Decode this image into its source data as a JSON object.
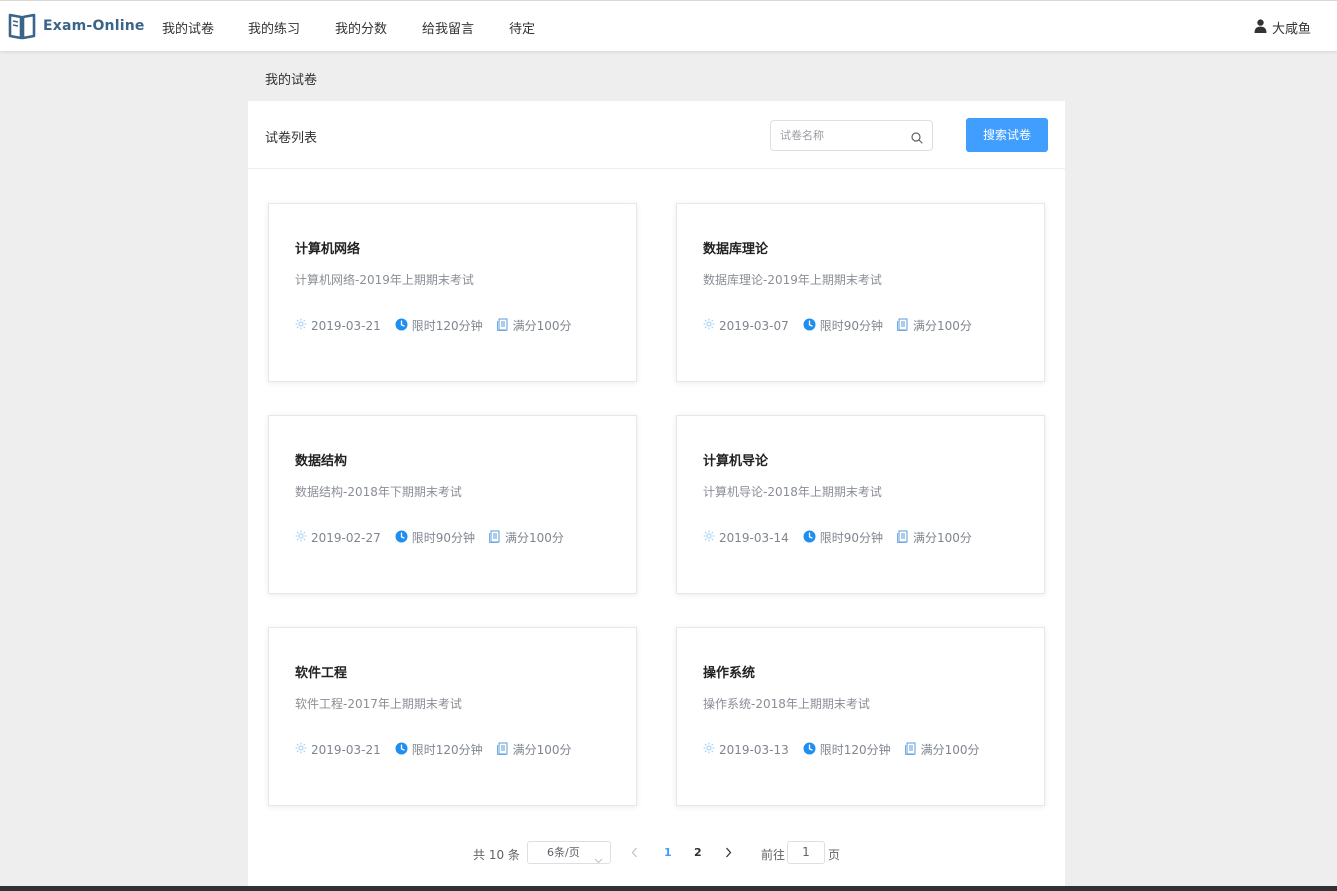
{
  "header": {
    "logo_text": "Exam-Online",
    "nav": [
      "我的试卷",
      "我的练习",
      "我的分数",
      "给我留言",
      "待定"
    ],
    "user_name": "大咸鱼"
  },
  "breadcrumb": "我的试卷",
  "panel": {
    "title": "试卷列表",
    "search_placeholder": "试卷名称",
    "search_button": "搜索试卷"
  },
  "cards": [
    {
      "title": "计算机网络",
      "desc": "计算机网络-2019年上期期末考试",
      "date": "2019-03-21",
      "time": "限时120分钟",
      "score": "满分100分"
    },
    {
      "title": "数据库理论",
      "desc": "数据库理论-2019年上期期末考试",
      "date": "2019-03-07",
      "time": "限时90分钟",
      "score": "满分100分"
    },
    {
      "title": "数据结构",
      "desc": "数据结构-2018年下期期末考试",
      "date": "2019-02-27",
      "time": "限时90分钟",
      "score": "满分100分"
    },
    {
      "title": "计算机导论",
      "desc": "计算机导论-2018年上期期末考试",
      "date": "2019-03-14",
      "time": "限时90分钟",
      "score": "满分100分"
    },
    {
      "title": "软件工程",
      "desc": "软件工程-2017年上期期末考试",
      "date": "2019-03-21",
      "time": "限时120分钟",
      "score": "满分100分"
    },
    {
      "title": "操作系统",
      "desc": "操作系统-2018年上期期末考试",
      "date": "2019-03-13",
      "time": "限时120分钟",
      "score": "满分100分"
    }
  ],
  "pagination": {
    "total": "共 10 条",
    "page_size": "6条/页",
    "pages": [
      "1",
      "2"
    ],
    "current_page": "1",
    "goto_label": "前往",
    "goto_value": "1",
    "page_suffix": "页"
  },
  "colors": {
    "brand_text": "#3a6488",
    "primary": "#409eff",
    "active_page": "#409eff",
    "date_icon": "#9ccef7",
    "clock_icon": "#1e8ef0",
    "doc_icon": "#5b9bdc"
  },
  "icons": {
    "logo": "open-book-icon",
    "user": "user-icon",
    "search": "search-icon",
    "date": "sun-icon",
    "time": "clock-icon",
    "score": "document-icon"
  }
}
